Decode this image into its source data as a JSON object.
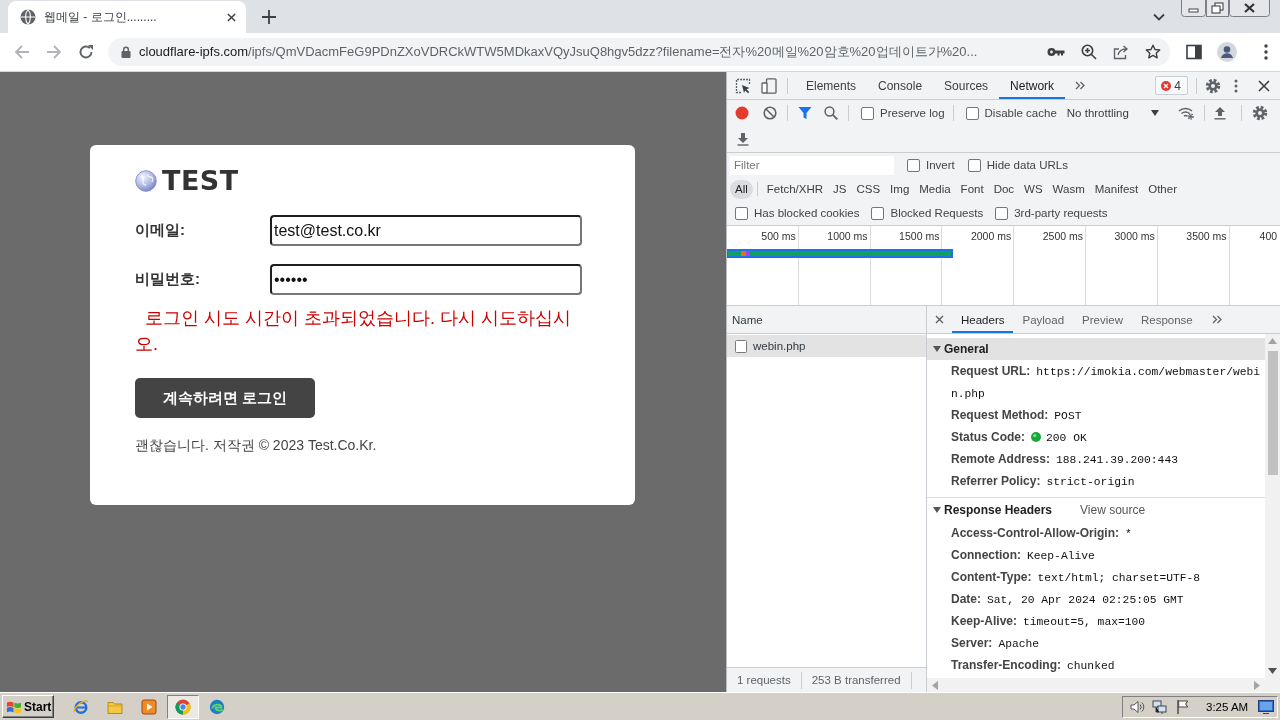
{
  "browser": {
    "tabs": [
      {
        "title": "웹메일 - 로그인.........",
        "selected": true
      }
    ],
    "address": {
      "host": "cloudflare-ipfs.com",
      "path": "/ipfs/QmVDacmFeG9PDnZXoVDRCkWTW5MDkaxVQyJsuQ8hgv5dzz?filename=전자%20메일%20암호%20업데이트가%20..."
    }
  },
  "login": {
    "logo": "TEST",
    "fields": [
      {
        "label": "이메일:",
        "value": "test@test.co.kr"
      },
      {
        "label": "비밀번호:",
        "value": "••••••"
      }
    ],
    "error": "로그인 시도 시간이 초과되었습니다. 다시 시도하십시오.",
    "button": "계속하려면 로그인",
    "footer": "괜찮습니다. 저작권 © 2023 Test.Co.Kr."
  },
  "devtools": {
    "tabs": [
      {
        "label": "Elements",
        "selected": false
      },
      {
        "label": "Console",
        "selected": false
      },
      {
        "label": "Sources",
        "selected": false
      },
      {
        "label": "Network",
        "selected": true
      }
    ],
    "error_count": "4",
    "toolbar": {
      "recording": true,
      "checkboxes": [
        {
          "label": "Preserve log",
          "checked": false
        },
        {
          "label": "Disable cache",
          "checked": false
        }
      ],
      "throttling": "No throttling"
    },
    "filter": {
      "placeholder": "Filter",
      "checkboxes": [
        {
          "label": "Invert",
          "checked": false
        },
        {
          "label": "Hide data URLs",
          "checked": false
        }
      ]
    },
    "types": [
      {
        "label": "All",
        "selected": true
      },
      {
        "label": "Fetch/XHR",
        "selected": false
      },
      {
        "label": "JS",
        "selected": false
      },
      {
        "label": "CSS",
        "selected": false
      },
      {
        "label": "Img",
        "selected": false
      },
      {
        "label": "Media",
        "selected": false
      },
      {
        "label": "Font",
        "selected": false
      },
      {
        "label": "Doc",
        "selected": false
      },
      {
        "label": "WS",
        "selected": false
      },
      {
        "label": "Wasm",
        "selected": false
      },
      {
        "label": "Manifest",
        "selected": false
      },
      {
        "label": "Other",
        "selected": false
      }
    ],
    "extra_filters": [
      {
        "label": "Has blocked cookies",
        "checked": false
      },
      {
        "label": "Blocked Requests",
        "checked": false
      },
      {
        "label": "3rd-party requests",
        "checked": false
      }
    ],
    "timeline": {
      "ticks": [
        "500 ms",
        "1000 ms",
        "1500 ms",
        "2000 ms",
        "2500 ms",
        "3000 ms",
        "3500 ms",
        "400"
      ]
    },
    "requests": {
      "column": "Name",
      "rows": [
        {
          "name": "webin.php",
          "selected": true
        }
      ],
      "summary": [
        "1 requests",
        "253 B transferred"
      ]
    },
    "details": {
      "tabs": [
        {
          "label": "Headers",
          "selected": true
        },
        {
          "label": "Payload",
          "selected": false
        },
        {
          "label": "Preview",
          "selected": false
        },
        {
          "label": "Response",
          "selected": false
        }
      ],
      "sections": [
        {
          "title": "General",
          "expanded": true,
          "selected": true,
          "rows": [
            {
              "name": "Request URL:",
              "value": "https://imokia.com/webmaster/webin.php",
              "kind": "text"
            },
            {
              "name": "Request Method:",
              "value": "POST",
              "kind": "text"
            },
            {
              "name": "Status Code:",
              "value": "200 OK",
              "kind": "status"
            },
            {
              "name": "Remote Address:",
              "value": "188.241.39.200:443",
              "kind": "text"
            },
            {
              "name": "Referrer Policy:",
              "value": "strict-origin",
              "kind": "text"
            }
          ]
        },
        {
          "title": "Response Headers",
          "expanded": true,
          "selected": false,
          "link": "View source",
          "rows": [
            {
              "name": "Access-Control-Allow-Origin:",
              "value": "*",
              "kind": "text"
            },
            {
              "name": "Connection:",
              "value": "Keep-Alive",
              "kind": "text"
            },
            {
              "name": "Content-Type:",
              "value": "text/html; charset=UTF-8",
              "kind": "text"
            },
            {
              "name": "Date:",
              "value": "Sat, 20 Apr 2024 02:25:05 GMT",
              "kind": "text"
            },
            {
              "name": "Keep-Alive:",
              "value": "timeout=5, max=100",
              "kind": "text"
            },
            {
              "name": "Server:",
              "value": "Apache",
              "kind": "text"
            },
            {
              "name": "Transfer-Encoding:",
              "value": "chunked",
              "kind": "text"
            }
          ]
        }
      ]
    }
  },
  "taskbar": {
    "start": "Start",
    "items": [
      {
        "selected": false
      },
      {
        "selected": false
      },
      {
        "selected": false
      },
      {
        "selected": true
      },
      {
        "selected": false
      }
    ],
    "clock": "3:25 AM"
  }
}
